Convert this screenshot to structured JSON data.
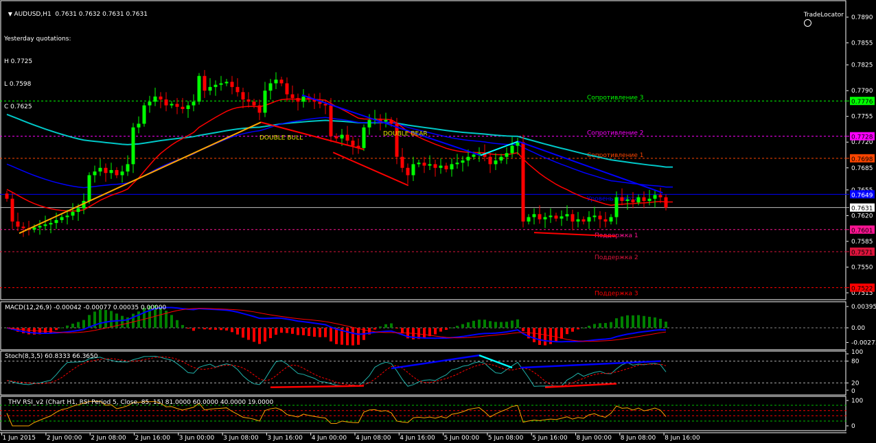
{
  "header": {
    "symbol_line": "AUDUSD,H1  0.7631 0.7632 0.7631 0.7631"
  },
  "yesterday": {
    "title": "Yesterday quotations:",
    "high": "H 0.7725",
    "low": "L 0.7598",
    "close": "C 0.7625"
  },
  "brand": {
    "label": "TradeLocator"
  },
  "colors": {
    "bull": "#00ff00",
    "bear": "#ff0000",
    "ma_slow": "#00c8c8",
    "ma_mid": "#0000ff",
    "ma_fast": "#ff0000",
    "stoch_main": "#20b2aa",
    "rsi": "#ffa500",
    "axis_text": "#ffffff"
  },
  "chart_data": {
    "type": "candlestick",
    "symbol": "AUDUSD",
    "timeframe": "H1",
    "ylim": [
      0.7511,
      0.7904
    ],
    "price_ticks": [
      "0.7890",
      "0.7855",
      "0.7825",
      "0.7790",
      "0.7755",
      "0.7720",
      "0.7685",
      "0.7655",
      "0.7620",
      "0.7585",
      "0.7550",
      "0.7515"
    ],
    "time_ticks": [
      "1 Jun 2015",
      "2 Jun 00:00",
      "2 Jun 08:00",
      "2 Jun 16:00",
      "3 Jun 00:00",
      "3 Jun 08:00",
      "3 Jun 16:00",
      "4 Jun 00:00",
      "4 Jun 08:00",
      "4 Jun 16:00",
      "5 Jun 00:00",
      "5 Jun 08:00",
      "5 Jun 16:00",
      "8 Jun 00:00",
      "8 Jun 08:00",
      "8 Jun 16:00"
    ],
    "closes": [
      0.7643,
      0.7612,
      0.7605,
      0.7603,
      0.7601,
      0.7604,
      0.7606,
      0.7608,
      0.761,
      0.7614,
      0.7618,
      0.762,
      0.7625,
      0.763,
      0.764,
      0.7675,
      0.768,
      0.7685,
      0.7678,
      0.7682,
      0.7675,
      0.768,
      0.769,
      0.774,
      0.7745,
      0.777,
      0.7775,
      0.7782,
      0.7778,
      0.777,
      0.7772,
      0.7768,
      0.7765,
      0.777,
      0.7775,
      0.781,
      0.779,
      0.7795,
      0.7798,
      0.78,
      0.7802,
      0.7795,
      0.7788,
      0.7778,
      0.7775,
      0.777,
      0.776,
      0.779,
      0.78,
      0.7805,
      0.78,
      0.7785,
      0.778,
      0.7775,
      0.7782,
      0.7778,
      0.7775,
      0.7772,
      0.777,
      0.7728,
      0.7725,
      0.773,
      0.7722,
      0.7715,
      0.7712,
      0.774,
      0.775,
      0.7752,
      0.7748,
      0.775,
      0.7745,
      0.77,
      0.7685,
      0.7675,
      0.769,
      0.7692,
      0.7688,
      0.769,
      0.7685,
      0.7688,
      0.7683,
      0.769,
      0.7692,
      0.7695,
      0.77,
      0.7703,
      0.7705,
      0.77,
      0.769,
      0.7695,
      0.77,
      0.7705,
      0.7715,
      0.772,
      0.7612,
      0.7618,
      0.7622,
      0.7615,
      0.7618,
      0.762,
      0.7616,
      0.7619,
      0.7622,
      0.7612,
      0.7615,
      0.7612,
      0.7618,
      0.762,
      0.7615,
      0.7612,
      0.7618,
      0.7645,
      0.764,
      0.7642,
      0.7638,
      0.7645,
      0.764,
      0.7643,
      0.7648,
      0.7645,
      0.7631
    ],
    "moving_averages": [
      {
        "name": "slow",
        "period": 100,
        "seed": 0.776,
        "color": "#00c8c8"
      },
      {
        "name": "mid",
        "period": 50,
        "seed": 0.7692,
        "color": "#0000ff"
      },
      {
        "name": "fast",
        "period": 21,
        "seed": 0.7657,
        "color": "#ff0000"
      }
    ],
    "levels": [
      {
        "price": 0.7776,
        "tag": "0.7776",
        "label": "Сопротивление 3",
        "color": "#00ff00",
        "text": "#000000",
        "dash": true
      },
      {
        "price": 0.7728,
        "tag": "0.7728",
        "label": "Сопротивление 2",
        "color": "#ff00ff",
        "text": "#000000",
        "dash": true
      },
      {
        "price": 0.7698,
        "tag": "0.7698",
        "label": "Сопротивление 1",
        "color": "#ff4500",
        "text": "#000000",
        "dash": true
      },
      {
        "price": 0.7649,
        "tag": "0.7649",
        "label": "Уровень пивота",
        "color": "#0000ff",
        "text": "#ffffff",
        "dash": false
      },
      {
        "price": 0.7631,
        "tag": "0.7631",
        "label": "",
        "color": "#c0c0c0",
        "text": "#000000",
        "dash": false,
        "tagbg": "#ffffff"
      },
      {
        "price": 0.7601,
        "tag": "0.7601",
        "label": "Поддержка 1",
        "color": "#ff1493",
        "text": "#000000",
        "dash": true
      },
      {
        "price": 0.7571,
        "tag": "0.7571",
        "label": "Поддержка 2",
        "color": "#dc143c",
        "text": "#000000",
        "dash": true
      },
      {
        "price": 0.7522,
        "tag": "0.7522",
        "label": "Поддержка 3",
        "color": "#ff0000",
        "text": "#000000",
        "dash": true
      }
    ],
    "trendlines": [
      {
        "from": [
          2.25,
          0.7596
        ],
        "to": [
          46.25,
          0.7747
        ],
        "color": "#ffa500"
      },
      {
        "from": [
          46.25,
          0.7747
        ],
        "to": [
          65,
          0.771
        ],
        "color": "#ff0000"
      },
      {
        "from": [
          59.4,
          0.7706
        ],
        "to": [
          73.1,
          0.7661
        ],
        "color": "#ff0000"
      },
      {
        "from": [
          53.75,
          0.7784
        ],
        "to": [
          86.25,
          0.7702
        ],
        "color": "#0000ff"
      },
      {
        "from": [
          86.25,
          0.7702
        ],
        "to": [
          93.1,
          0.7721
        ],
        "color": "#00ffff"
      },
      {
        "from": [
          93.1,
          0.7721
        ],
        "to": [
          119.4,
          0.7651
        ],
        "color": "#0000ff"
      },
      {
        "from": [
          96,
          0.7597
        ],
        "to": [
          111,
          0.7592
        ],
        "color": "#ff0000"
      }
    ],
    "patterns": [
      {
        "label": "DOUBLE  BULL",
        "bar": 51,
        "price": 0.7727
      },
      {
        "label": "DOUBLE  BEAR",
        "bar": 73.5,
        "price": 0.7733
      }
    ],
    "macd": {
      "title": "MACD(12,26,9) -0.00042 -0.00077 0.00035 0.00000",
      "ylim": [
        -0.003,
        0.0043
      ],
      "ticks": [
        "0.00395",
        "0.00",
        "-0.00273"
      ],
      "tick_values": [
        0.00395,
        0,
        -0.00273
      ]
    },
    "stoch": {
      "title": "Stoch(8,3,5) 60.8333 66.3650",
      "k": 8,
      "slowing": 3,
      "d": 5,
      "ticks": [
        "100",
        "80",
        "20",
        "0"
      ],
      "tick_values": [
        100,
        80,
        20,
        0
      ],
      "trendlines": [
        {
          "from": [
            48,
            8
          ],
          "to": [
            65,
            12
          ],
          "color": "#ff0000"
        },
        {
          "from": [
            70,
            60
          ],
          "to": [
            86,
            96
          ],
          "color": "#0000ff"
        },
        {
          "from": [
            86,
            96
          ],
          "to": [
            92,
            62
          ],
          "color": "#00ffff"
        },
        {
          "from": [
            93.5,
            62
          ],
          "to": [
            119,
            80
          ],
          "color": "#0000ff"
        },
        {
          "from": [
            98,
            8
          ],
          "to": [
            111,
            18
          ],
          "color": "#ff0000"
        }
      ]
    },
    "rsi": {
      "title": "THV RSI_v2   (Chart H1,  RSI Period 5,  Close,  85,  15)  81.0000 60.0000 40.0000 19.0000",
      "period": 5,
      "levels": [
        81,
        60,
        40,
        19
      ],
      "ticks": [
        "100",
        "0"
      ],
      "tick_values": [
        100,
        0
      ]
    }
  }
}
